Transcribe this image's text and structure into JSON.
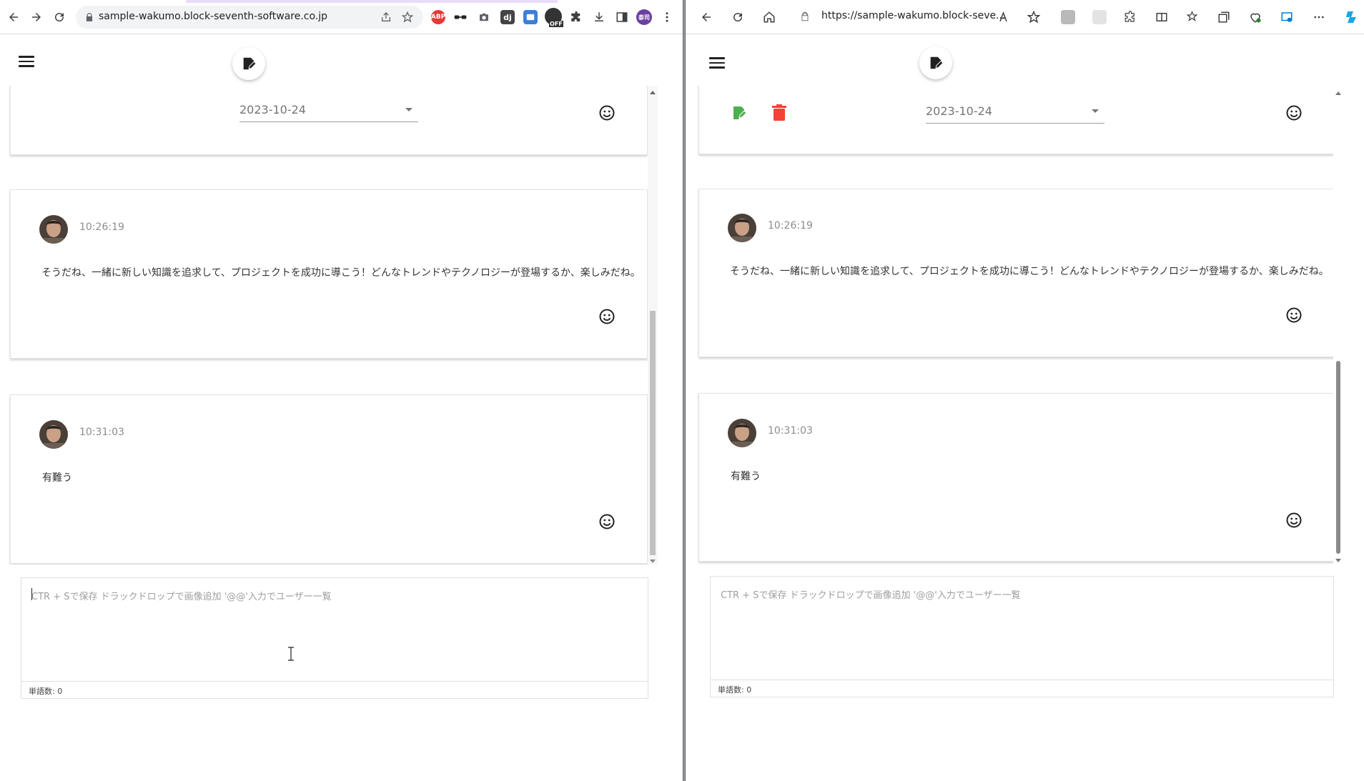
{
  "left_browser": {
    "url": "sample-wakumo.block-seventh-software.co.jp",
    "extensions": [
      "ABP",
      "OFF",
      "泰司"
    ]
  },
  "right_browser": {
    "url": "https://sample-wakumo.block-seve..."
  },
  "app": {
    "date_value": "2023-10-24",
    "messages": [
      {
        "time": "10:26:19",
        "text": "そうだね、一緒に新しい知識を追求して、プロジェクトを成功に導こう！どんなトレンドやテクノロジーが登場するか、楽しみだね。"
      },
      {
        "time": "10:31:03",
        "text": "有難う"
      }
    ],
    "editor_placeholder": "CTR + Sで保存 ドラックドロップで画像追加 '@@'入力でユーザー一覧",
    "word_count": "単語数: 0"
  },
  "colors": {
    "edit_green": "#4caf50",
    "delete_red": "#f44336",
    "divider": "#5f6368"
  }
}
